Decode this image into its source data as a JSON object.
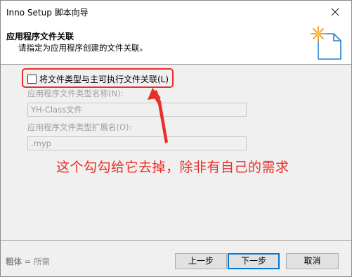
{
  "window": {
    "title": "Inno Setup 脚本向导",
    "close_symbol": "✕"
  },
  "header": {
    "title": "应用程序文件关联",
    "subtitle": "请指定为应用程序创建的文件关联。",
    "icon": "wizard-star-document-icon"
  },
  "form": {
    "associate_checkbox": {
      "label": "将文件类型与主可执行文件关联(L)",
      "checked": false
    },
    "file_type_name": {
      "label": "应用程序文件类型名称(N):",
      "value": "YH-Class文件"
    },
    "file_type_ext": {
      "label": "应用程序文件类型扩展名(O):",
      "value": ".myp"
    }
  },
  "annotation": {
    "text": "这个勾勾给它去掉，除非有自己的需求",
    "color": "#e8302a"
  },
  "footer": {
    "watermark_bold": "粗体",
    "watermark_rest": " = 所需",
    "back_label": "上一步",
    "next_label": "下一步",
    "cancel_label": "取消"
  }
}
